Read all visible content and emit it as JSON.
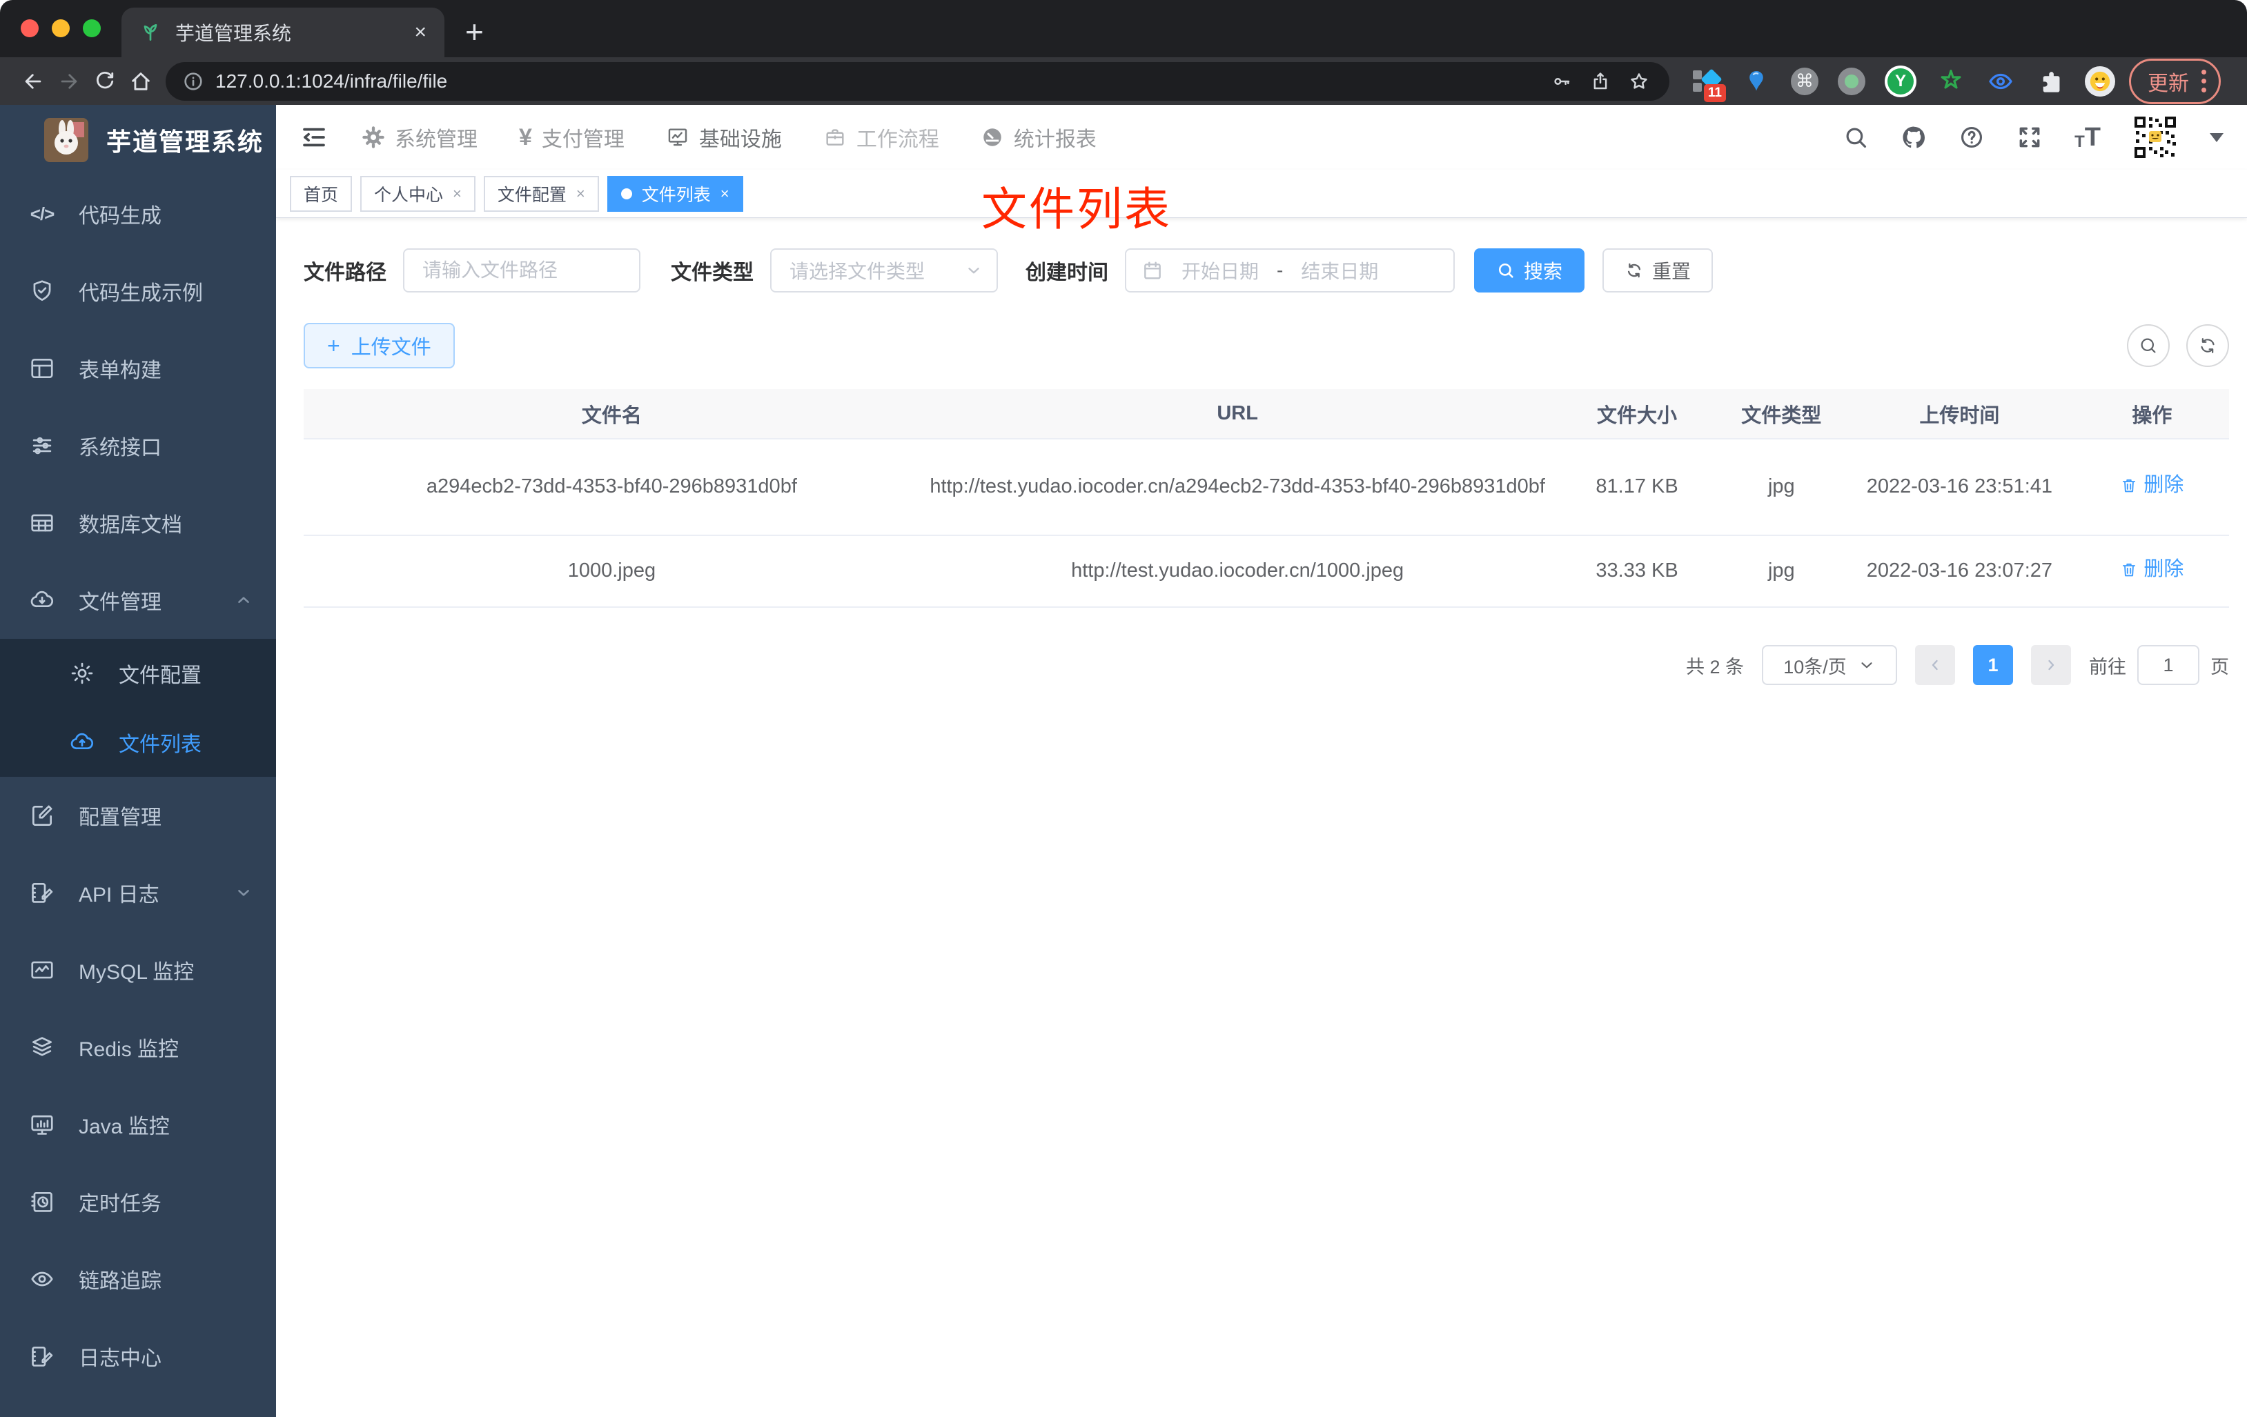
{
  "browser": {
    "tab_title": "芋道管理系统",
    "url": "127.0.0.1:1024/infra/file/file",
    "extension_badge": "11",
    "extension_y_letter": "Y",
    "update_label": "更新"
  },
  "app": {
    "sidebar": {
      "title": "芋道管理系统",
      "items": [
        {
          "label": "代码生成"
        },
        {
          "label": "代码生成示例"
        },
        {
          "label": "表单构建"
        },
        {
          "label": "系统接口"
        },
        {
          "label": "数据库文档"
        },
        {
          "label": "文件管理",
          "expanded": true,
          "children": [
            {
              "label": "文件配置"
            },
            {
              "label": "文件列表",
              "active": true
            }
          ]
        },
        {
          "label": "配置管理"
        },
        {
          "label": "API 日志",
          "expanded": false
        },
        {
          "label": "MySQL 监控"
        },
        {
          "label": "Redis 监控"
        },
        {
          "label": "Java 监控"
        },
        {
          "label": "定时任务"
        },
        {
          "label": "链路追踪"
        },
        {
          "label": "日志中心"
        }
      ]
    },
    "header": {
      "nav": [
        {
          "label": "系统管理"
        },
        {
          "label": "支付管理"
        },
        {
          "label": "基础设施",
          "current": true
        },
        {
          "label": "工作流程"
        },
        {
          "label": "统计报表"
        }
      ]
    },
    "tags": [
      {
        "label": "首页",
        "closable": false,
        "active": false
      },
      {
        "label": "个人中心",
        "closable": true,
        "active": false
      },
      {
        "label": "文件配置",
        "closable": true,
        "active": false
      },
      {
        "label": "文件列表",
        "closable": true,
        "active": true
      }
    ],
    "annotation": "文件列表",
    "filters": {
      "path_label": "文件路径",
      "path_placeholder": "请输入文件路径",
      "type_label": "文件类型",
      "type_placeholder": "请选择文件类型",
      "time_label": "创建时间",
      "start_placeholder": "开始日期",
      "range_separator": "-",
      "end_placeholder": "结束日期",
      "search_label": "搜索",
      "reset_label": "重置"
    },
    "toolbar": {
      "upload_label": "上传文件"
    },
    "table": {
      "columns": [
        "文件名",
        "URL",
        "文件大小",
        "文件类型",
        "上传时间",
        "操作"
      ],
      "rows": [
        {
          "name": "a294ecb2-73dd-4353-bf40-296b8931d0bf",
          "url": "http://test.yudao.iocoder.cn/a294ecb2-73dd-4353-bf40-296b8931d0bf",
          "size": "81.17 KB",
          "type": "jpg",
          "time": "2022-03-16 23:51:41",
          "action": "删除"
        },
        {
          "name": "1000.jpeg",
          "url": "http://test.yudao.iocoder.cn/1000.jpeg",
          "size": "33.33 KB",
          "type": "jpg",
          "time": "2022-03-16 23:07:27",
          "action": "删除"
        }
      ]
    },
    "pagination": {
      "total": "共 2 条",
      "page_size": "10条/页",
      "current_page": "1",
      "goto_label": "前往",
      "goto_value": "1",
      "page_unit": "页"
    }
  },
  "colors": {
    "accent": "#409eff",
    "sidebar_bg": "#304156",
    "submenu_bg": "#1f2d3d",
    "annotation_red": "#ff2600",
    "update_salmon": "#ef928a",
    "chrome_dark": "#1f2023",
    "chrome_toolbar": "#35363a",
    "table_header_bg": "#f8f8f9"
  }
}
